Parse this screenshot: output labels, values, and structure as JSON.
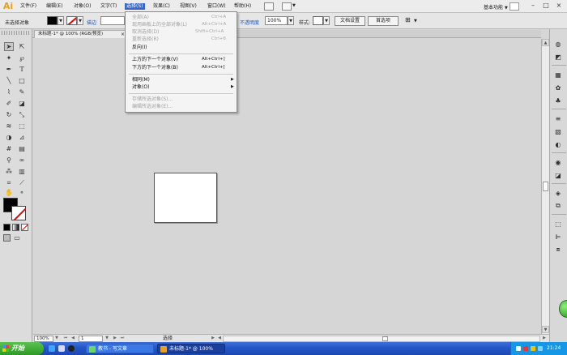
{
  "app": {
    "logo": "Ai",
    "workspace": "基本功能"
  },
  "menubar": {
    "items": [
      "文件(F)",
      "编辑(E)",
      "对象(O)",
      "文字(T)",
      "选择(S)",
      "效果(C)",
      "视图(V)",
      "窗口(W)",
      "帮助(H)"
    ],
    "active_item": "选择(S)"
  },
  "window_controls": {
    "minimize": "–",
    "maximize": "□",
    "close": "×"
  },
  "controlbar": {
    "selection_label": "未选择对象",
    "stroke_label": "描边",
    "opacity_label": "不透明度",
    "opacity_value": "100%",
    "style_label": "样式:",
    "doc_setup_label": "文档设置",
    "preferences_label": "首选项"
  },
  "document_tab": {
    "label": "未标题-1* @ 100% (RGB/预览)",
    "close": "×"
  },
  "select_menu": {
    "items": [
      {
        "label": "全部(A)",
        "shortcut": "Ctrl+A",
        "disabled": true
      },
      {
        "label": "现用画板上的全部对象(L)",
        "shortcut": "Alt+Ctrl+A",
        "disabled": true
      },
      {
        "label": "取消选择(D)",
        "shortcut": "Shift+Ctrl+A",
        "disabled": true
      },
      {
        "label": "重新选择(R)",
        "shortcut": "Ctrl+6",
        "disabled": true
      },
      {
        "label": "反向(I)",
        "shortcut": "",
        "disabled": false
      },
      {
        "label": "上方的下一个对象(V)",
        "shortcut": "Alt+Ctrl+]",
        "disabled": false
      },
      {
        "label": "下方的下一个对象(B)",
        "shortcut": "Alt+Ctrl+[",
        "disabled": false
      },
      {
        "label": "相同(M)",
        "shortcut": "",
        "disabled": false,
        "submenu": true
      },
      {
        "label": "对象(O)",
        "shortcut": "",
        "disabled": false,
        "submenu": true
      },
      {
        "label": "存储所选对象(S)...",
        "shortcut": "",
        "disabled": true
      },
      {
        "label": "编辑所选对象(E)...",
        "shortcut": "",
        "disabled": true
      }
    ]
  },
  "statusbar": {
    "zoom": "100%",
    "page": "1",
    "tool_label": "选择"
  },
  "taskbar": {
    "start_label": "开始",
    "tasks": [
      {
        "label": "教书 - 写文章",
        "active": false
      },
      {
        "label": "未标题-1* @ 100%",
        "active": true
      }
    ],
    "clock": "21:24"
  },
  "icons": {
    "tools": [
      "selection-tool-icon",
      "direct-selection-tool-icon",
      "magic-wand-icon",
      "lasso-icon",
      "pen-icon",
      "type-icon",
      "line-icon",
      "rectangle-icon",
      "paintbrush-icon",
      "pencil-icon",
      "blob-brush-icon",
      "eraser-icon",
      "rotate-icon",
      "scale-icon",
      "warp-icon",
      "free-transform-icon",
      "shape-builder-icon",
      "perspective-grid-icon",
      "mesh-icon",
      "gradient-icon",
      "eyedropper-icon",
      "blend-icon",
      "symbol-sprayer-icon",
      "column-graph-icon",
      "artboard-tool-icon",
      "slice-icon",
      "hand-icon",
      "zoom-icon"
    ],
    "panels": [
      "color-panel-icon",
      "color-guide-icon",
      "swatches-icon",
      "brushes-icon",
      "symbols-icon",
      "stroke-icon",
      "gradient-panel-icon",
      "transparency-icon",
      "appearance-icon",
      "graphic-styles-icon",
      "layers-icon",
      "artboards-icon",
      "align-icon",
      "transform-icon",
      "pathfinder-icon"
    ]
  },
  "colors": {
    "menu_highlight": "#3a67c4",
    "taskbar": "#2456c8",
    "start_green": "#3aa32f",
    "stroke_none": "#e00000"
  }
}
